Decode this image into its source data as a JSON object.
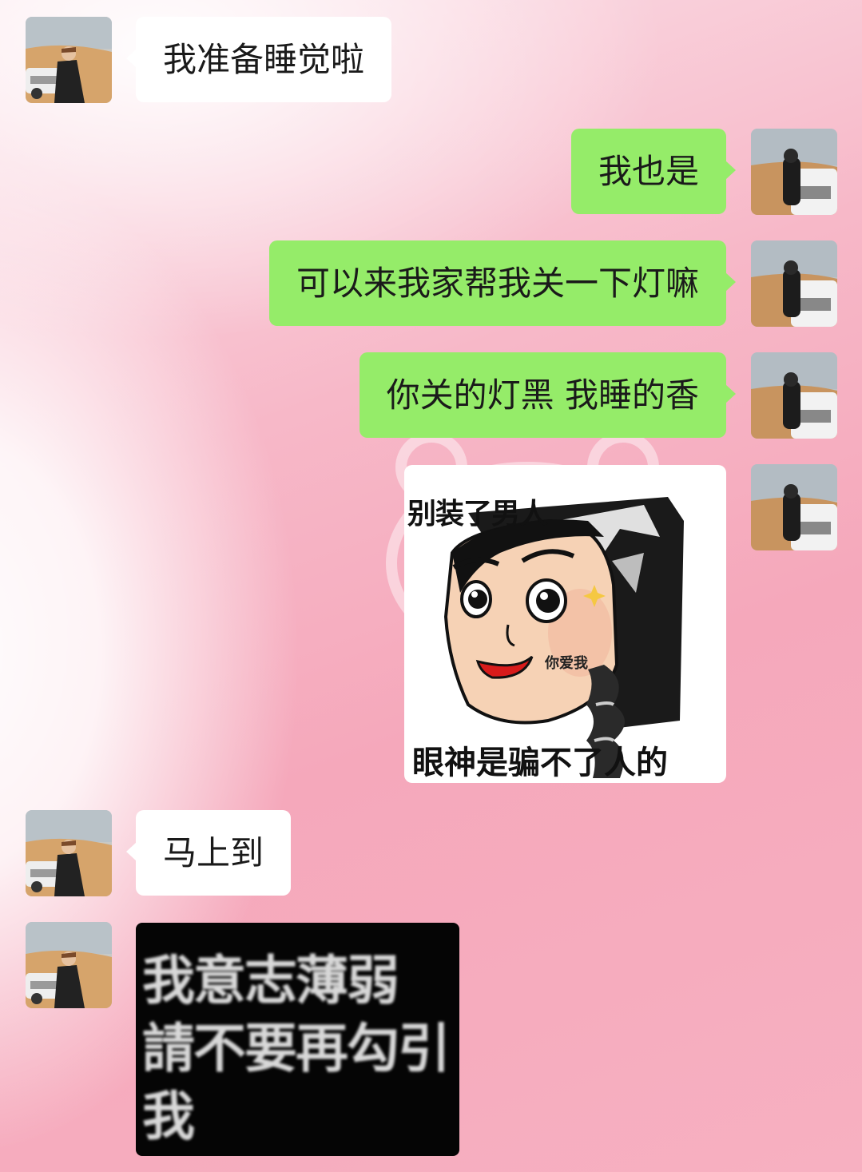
{
  "messages": [
    {
      "side": "left",
      "text": "我准备睡觉啦"
    },
    {
      "side": "right",
      "text": "我也是"
    },
    {
      "side": "right",
      "text": "可以来我家帮我关一下灯嘛"
    },
    {
      "side": "right",
      "text": "你关的灯黑 我睡的香"
    },
    {
      "side": "left",
      "text": "马上到"
    }
  ],
  "stickers": {
    "girl": {
      "caption_top": "别装了男人",
      "caption_mid": "你爱我",
      "caption_bottom": "眼神是骗不了人的"
    },
    "black": {
      "line1": "我意志薄弱",
      "line2": "請不要再勾引",
      "line3": "我"
    }
  },
  "colors": {
    "right_bubble": "#95ec69",
    "left_bubble": "#ffffff"
  }
}
